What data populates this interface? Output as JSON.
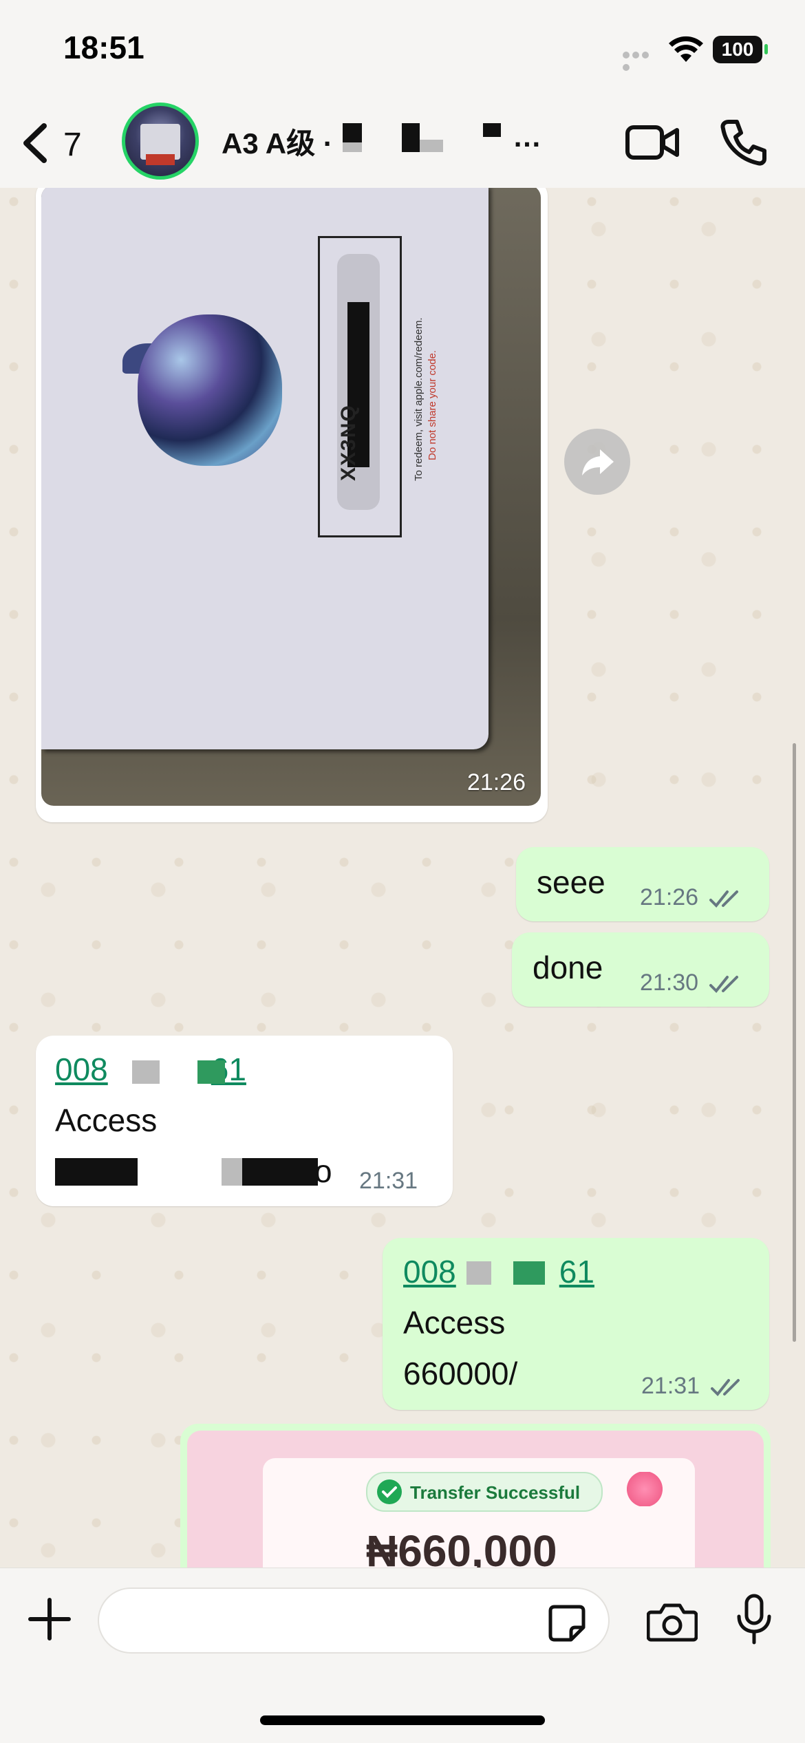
{
  "status_bar": {
    "time": "18:51",
    "battery": "100"
  },
  "header": {
    "back_count": "7",
    "chat_title": "A3 A级 ·",
    "chat_title_ellipsis": "…"
  },
  "messages": [
    {
      "type": "image",
      "direction": "incoming",
      "time": "21:26",
      "card_code": "XX3NQ",
      "card_note": "To redeem, visit apple.com/redeem.",
      "card_warning": "Do not share your code."
    },
    {
      "type": "text",
      "direction": "outgoing",
      "text": "seee",
      "time": "21:26",
      "status": "read"
    },
    {
      "type": "text",
      "direction": "outgoing",
      "text": "done",
      "time": "21:30",
      "status": "read"
    },
    {
      "type": "text",
      "direction": "incoming",
      "link": "008",
      "link_end": "61",
      "line2": "Access",
      "line3_end": "o",
      "time": "21:31"
    },
    {
      "type": "text",
      "direction": "outgoing",
      "link": "008",
      "link_end": "61",
      "line2": "Access",
      "line3": "660000/",
      "time": "21:31",
      "status": "read"
    },
    {
      "type": "image",
      "direction": "outgoing",
      "transfer_status": "Transfer Successful",
      "amount": "₦660,000"
    }
  ],
  "composer": {
    "placeholder": ""
  },
  "icons": {
    "back": "chevron-left-icon",
    "video": "video-camera-icon",
    "phone": "phone-icon",
    "forward": "forward-icon",
    "scroll_down": "chevron-down-icon",
    "plus": "plus-icon",
    "sticker": "sticker-icon",
    "camera": "camera-icon",
    "mic": "microphone-icon"
  },
  "colors": {
    "outgoing_bubble": "#d9fdd3",
    "incoming_bubble": "#ffffff",
    "link": "#0f8a5f",
    "accent_green": "#25d366"
  }
}
